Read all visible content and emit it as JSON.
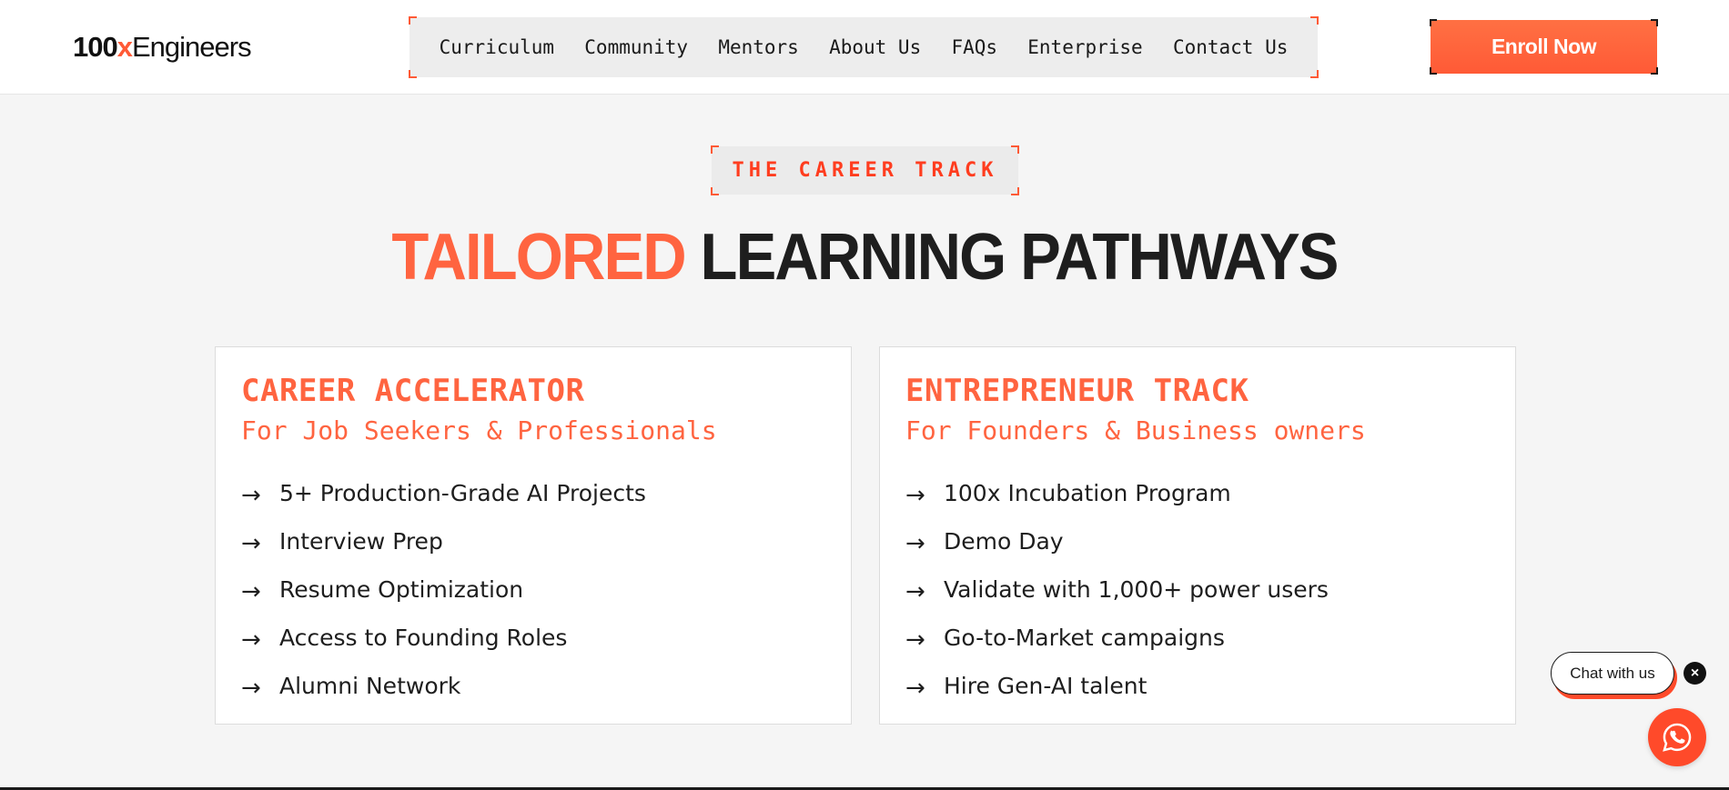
{
  "brand": {
    "logo_num": "100",
    "logo_x": "x",
    "logo_text": "Engineers",
    "accent": "#ff5a36",
    "dark": "#1e1e1e"
  },
  "nav": {
    "items": [
      "Curriculum",
      "Community",
      "Mentors",
      "About Us",
      "FAQs",
      "Enterprise",
      "Contact Us"
    ],
    "enroll_label": "Enroll Now"
  },
  "section": {
    "tag": "THE CAREER TRACK",
    "headline_highlight": "TAILORED",
    "headline_rest": "LEARNING PATHWAYS"
  },
  "cards": [
    {
      "title": "CAREER ACCELERATOR",
      "subtitle": "For Job Seekers & Professionals",
      "features": [
        "5+ Production-Grade AI Projects",
        "Interview Prep",
        "Resume Optimization",
        "Access to Founding Roles",
        "Alumni Network"
      ]
    },
    {
      "title": "ENTREPRENEUR TRACK",
      "subtitle": "For Founders & Business owners",
      "features": [
        "100x Incubation Program",
        "Demo Day",
        "Validate with 1,000+ power users",
        "Go-to-Market campaigns",
        "Hire Gen-AI talent"
      ]
    }
  ],
  "chat": {
    "pill_label": "Chat with us",
    "close_glyph": "×",
    "icon": "whatsapp-icon"
  },
  "list_arrow": "→"
}
